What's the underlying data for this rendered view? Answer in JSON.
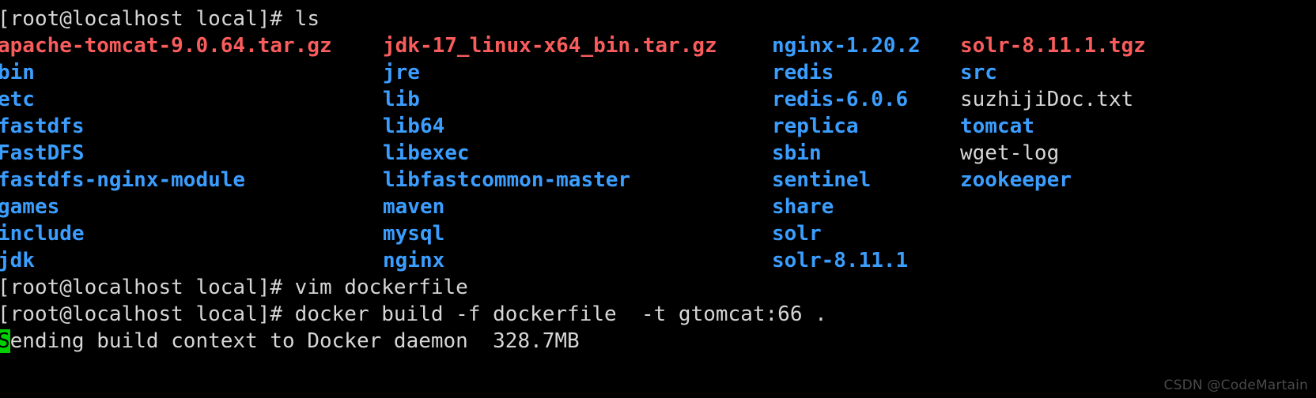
{
  "terminal": {
    "background_color": "#000000",
    "default_text_color": "#d6d6d6",
    "directory_color": "#3b9eff",
    "archive_color": "#f85c5c",
    "cursor_background_color": "#00d000",
    "cursor_foreground_color": "#000000",
    "prompt": "[root@localhost local]# ",
    "lines": {
      "ls_command": "[root@localhost local]# ls",
      "vim_command": "[root@localhost local]# vim dockerfile",
      "docker_command": "[root@localhost local]# docker build -f dockerfile  -t gtomcat:66 .",
      "build_output": "ending build context to Docker daemon  328.7MB",
      "build_output_cursor_char": "S"
    }
  },
  "listing": {
    "rows": [
      {
        "col1": {
          "text": "apache-tomcat-9.0.64.tar.gz",
          "kind": "archive"
        },
        "col2": {
          "text": "jdk-17_linux-x64_bin.tar.gz",
          "kind": "archive"
        },
        "col3": {
          "text": "nginx-1.20.2",
          "kind": "dir"
        },
        "col4": {
          "text": "solr-8.11.1.tgz",
          "kind": "archive"
        }
      },
      {
        "col1": {
          "text": "bin",
          "kind": "dir"
        },
        "col2": {
          "text": "jre",
          "kind": "dir"
        },
        "col3": {
          "text": "redis",
          "kind": "dir"
        },
        "col4": {
          "text": "src",
          "kind": "dir"
        }
      },
      {
        "col1": {
          "text": "etc",
          "kind": "dir"
        },
        "col2": {
          "text": "lib",
          "kind": "dir"
        },
        "col3": {
          "text": "redis-6.0.6",
          "kind": "dir"
        },
        "col4": {
          "text": "suzhijiDoc.txt",
          "kind": "file"
        }
      },
      {
        "col1": {
          "text": "fastdfs",
          "kind": "dir"
        },
        "col2": {
          "text": "lib64",
          "kind": "dir"
        },
        "col3": {
          "text": "replica",
          "kind": "dir"
        },
        "col4": {
          "text": "tomcat",
          "kind": "dir"
        }
      },
      {
        "col1": {
          "text": "FastDFS",
          "kind": "dir"
        },
        "col2": {
          "text": "libexec",
          "kind": "dir"
        },
        "col3": {
          "text": "sbin",
          "kind": "dir"
        },
        "col4": {
          "text": "wget-log",
          "kind": "file"
        }
      },
      {
        "col1": {
          "text": "fastdfs-nginx-module",
          "kind": "dir"
        },
        "col2": {
          "text": "libfastcommon-master",
          "kind": "dir"
        },
        "col3": {
          "text": "sentinel",
          "kind": "dir"
        },
        "col4": {
          "text": "zookeeper",
          "kind": "dir"
        }
      },
      {
        "col1": {
          "text": "games",
          "kind": "dir"
        },
        "col2": {
          "text": "maven",
          "kind": "dir"
        },
        "col3": {
          "text": "share",
          "kind": "dir"
        },
        "col4": {
          "text": "",
          "kind": "file"
        }
      },
      {
        "col1": {
          "text": "include",
          "kind": "dir"
        },
        "col2": {
          "text": "mysql",
          "kind": "dir"
        },
        "col3": {
          "text": "solr",
          "kind": "dir"
        },
        "col4": {
          "text": "",
          "kind": "file"
        }
      },
      {
        "col1": {
          "text": "jdk",
          "kind": "dir"
        },
        "col2": {
          "text": "nginx",
          "kind": "dir"
        },
        "col3": {
          "text": "solr-8.11.1",
          "kind": "dir"
        },
        "col4": {
          "text": "",
          "kind": "file"
        }
      }
    ]
  },
  "watermark": {
    "text": "CSDN @CodeMartain"
  }
}
